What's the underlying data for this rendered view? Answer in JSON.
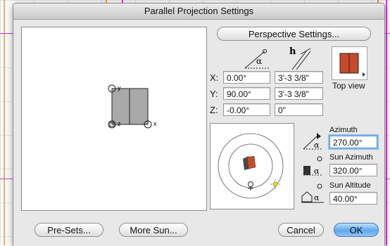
{
  "dialog": {
    "title": "Parallel Projection Settings"
  },
  "buttons": {
    "perspective": "Perspective Settings...",
    "presets": "Pre-Sets...",
    "more_sun": "More Sun...",
    "cancel": "Cancel",
    "ok": "OK"
  },
  "preview": {
    "axis_x": "x",
    "axis_y": "y",
    "axis_z": "z"
  },
  "coords": {
    "angle_symbol": "α",
    "height_symbol": "h",
    "x_label": "X:",
    "y_label": "Y:",
    "z_label": "Z:",
    "x_angle": "0.00°",
    "x_offset": "3'-3 3/8\"",
    "y_angle": "90.00°",
    "y_offset": "3'-3 3/8\"",
    "z_angle": "-0.00°",
    "z_offset": "0\""
  },
  "view": {
    "label": "Top view"
  },
  "sun": {
    "azimuth_label": "Azimuth",
    "azimuth_value": "270.00°",
    "sun_azimuth_label": "Sun Azimuth",
    "sun_azimuth_value": "320.00°",
    "sun_altitude_label": "Sun Altitude",
    "sun_altitude_value": "40.00°"
  },
  "colors": {
    "accent_red": "#c84a2a",
    "accent_dark": "#4a4a4a",
    "default_button": "#5fa8eb",
    "focus_ring": "#8ebde8",
    "backdrop_magenta": "#d43ec8",
    "backdrop_orange": "#e39a4a"
  }
}
